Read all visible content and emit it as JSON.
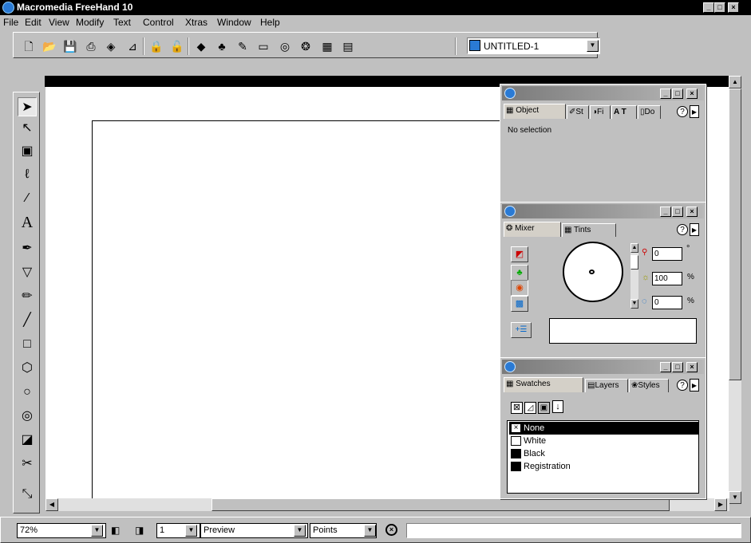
{
  "window": {
    "title": "Macromedia FreeHand 10",
    "min": "_",
    "max": "□",
    "close": "×"
  },
  "menu": [
    "File",
    "Edit",
    "View",
    "Modify",
    "Text",
    "Control",
    "Xtras",
    "Window",
    "Help"
  ],
  "toolbar": {
    "document_name": "UNTITLED-1",
    "icons": [
      "new-icon",
      "open-icon",
      "save-icon",
      "import-icon",
      "export-icon",
      "print-icon",
      "lock-icon",
      "unlock-icon",
      "group-icon",
      "ungroup-icon",
      "text-editor-icon",
      "library-icon",
      "publish-icon",
      "color-mixer-icon",
      "swatches-icon",
      "layers-icon"
    ]
  },
  "tools": [
    "pointer-tool",
    "subselect-tool",
    "page-tool",
    "lasso-tool",
    "eyedropper-tool",
    "text-tool",
    "pen-tool",
    "bezigon-tool",
    "pencil-tool",
    "line-tool",
    "rectangle-tool",
    "polygon-tool",
    "ellipse-tool",
    "spiral-tool",
    "zoom-tool",
    "knife-tool",
    "scale-tool"
  ],
  "object_panel": {
    "tabs": [
      "Object",
      "St",
      "Fi",
      "A T",
      "Do"
    ],
    "active_tab": "Object",
    "content": "No selection",
    "help": "?"
  },
  "mixer_panel": {
    "tabs": [
      "Mixer",
      "Tints"
    ],
    "active_tab": "Mixer",
    "hue": "0",
    "hue_unit": "°",
    "lightness": "100",
    "lightness_unit": "%",
    "saturation": "0",
    "saturation_unit": "%",
    "help": "?"
  },
  "swatches_panel": {
    "tabs": [
      "Swatches",
      "Layers",
      "Styles"
    ],
    "active_tab": "Swatches",
    "help": "?",
    "swatches": [
      {
        "name": "None",
        "color": "none",
        "selected": true
      },
      {
        "name": "White",
        "color": "#ffffff",
        "selected": false
      },
      {
        "name": "Black",
        "color": "#000000",
        "selected": false
      },
      {
        "name": "Registration",
        "color": "#000000",
        "selected": false
      }
    ]
  },
  "status": {
    "zoom": "72%",
    "page": "1",
    "view_mode": "Preview",
    "units": "Points"
  },
  "colors": {
    "titlebar": "#000000",
    "chrome": "#c0c0c0",
    "selection": "#000000"
  }
}
